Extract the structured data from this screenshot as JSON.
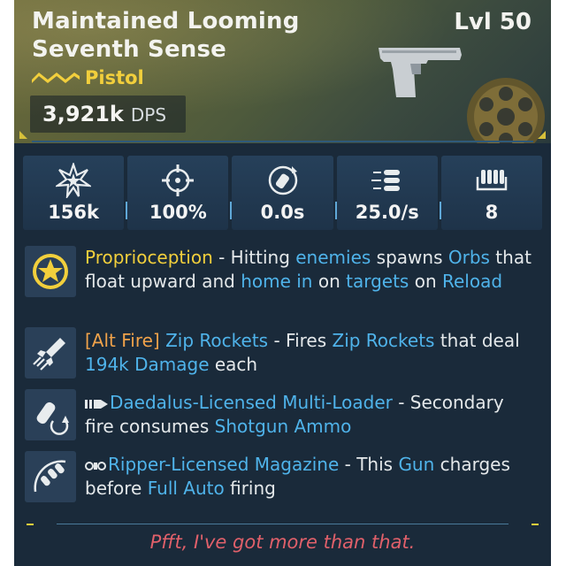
{
  "item": {
    "title": "Maintained Looming Seventh Sense",
    "level": "Lvl 50",
    "weapon_type": "Pistol",
    "dps_value": "3,921k",
    "dps_label": "DPS",
    "rarity_color": "#f2cf3c"
  },
  "stats": [
    {
      "icon": "burst-damage-icon",
      "value": "156k"
    },
    {
      "icon": "crosshair-accuracy-icon",
      "value": "100%"
    },
    {
      "icon": "reload-time-icon",
      "value": "0.0s"
    },
    {
      "icon": "fire-rate-icon",
      "value": "25.0/s"
    },
    {
      "icon": "magazine-ammo-icon",
      "value": "8"
    }
  ],
  "perks": [
    {
      "icon": "star-medal-icon",
      "name": "Proprioception",
      "sep": " - Hitting ",
      "k1": "enemies",
      "t1": " spawns ",
      "k2": "Orbs",
      "t2": " that float upward and ",
      "k3": "home in",
      "t3": " on ",
      "k4": "targets",
      "t4": " on ",
      "k5": "Reload"
    },
    {
      "icon": "rocket-icon",
      "tag": "[Alt Fire]",
      "name": "Zip Rockets",
      "sep": " - Fires ",
      "k1": "Zip Rockets",
      "t1": " that deal ",
      "k2": "194k Damage",
      "t2": " each"
    },
    {
      "icon": "shell-reload-icon",
      "name": "Daedalus-Licensed Multi-Loader",
      "sep": " - Secondary fire consumes ",
      "k1": "Shotgun Ammo"
    },
    {
      "icon": "ripper-magazine-icon",
      "name": "Ripper-Licensed Magazine",
      "sep": " - This ",
      "k1": "Gun",
      "t1": " charges before ",
      "k2": "Full Auto",
      "t2": " firing"
    }
  ],
  "flavor_text": "Pfft, I've got more than that."
}
